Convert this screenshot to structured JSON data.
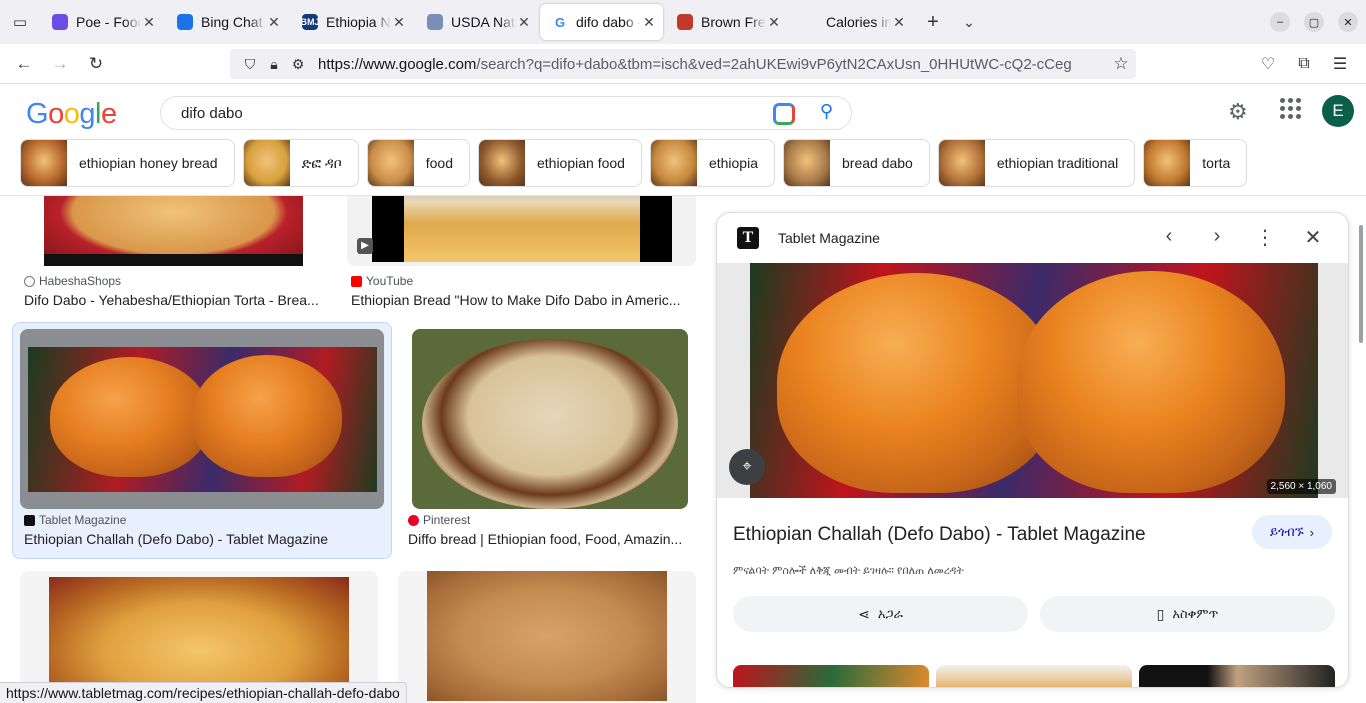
{
  "browser": {
    "tabs": [
      {
        "title": "Poe - Food Rec",
        "fav_color": "#6b4ce6",
        "fav_text": ""
      },
      {
        "title": "Bing Chat with",
        "fav_color": "#1a73e8",
        "fav_text": ""
      },
      {
        "title": "Ethiopia Nation",
        "fav_color": "#123a7a",
        "fav_text": "BMJ"
      },
      {
        "title": "USDA National",
        "fav_color": "#7a8fb5",
        "fav_text": ""
      },
      {
        "title": "difo dabo - Goo",
        "fav_color": "#4285f4",
        "fav_text": "G",
        "active": true
      },
      {
        "title": "Brown Fresh Gi",
        "fav_color": "#c0392b",
        "fav_text": ""
      },
      {
        "title": "Calories in large C",
        "fav_color": "#f0f0f4",
        "fav_text": ""
      }
    ],
    "url_host": "https://www.google.com",
    "url_rest": "/search?q=difo+dabo&tbm=isch&ved=2ahUKEwi9vP6ytN2CAxUsn_0HHUtWC-cQ2-cCeg",
    "status_url": "https://www.tabletmag.com/recipes/ethiopian-challah-defo-dabo"
  },
  "google": {
    "logo": "Google",
    "query": "difo dabo",
    "avatar_letter": "E",
    "chips": [
      {
        "label": "ethiopian honey bread",
        "color": "#b5652a"
      },
      {
        "label": "ድፎ ዳቦ",
        "color": "#d6a03c"
      },
      {
        "label": "food",
        "color": "#c98d4a"
      },
      {
        "label": "ethiopian food",
        "color": "#8f5a2e"
      },
      {
        "label": "ethiopia",
        "color": "#c4883d"
      },
      {
        "label": "bread dabo",
        "color": "#a87a4a"
      },
      {
        "label": "ethiopian traditional",
        "color": "#b07038"
      },
      {
        "label": "torta",
        "color": "#c0782e"
      }
    ]
  },
  "results": [
    {
      "source": "HabeshaShops",
      "caption": "Difo Dabo - Yehabesha/Ethiopian Torta - Brea...",
      "src_color": "#777"
    },
    {
      "source": "YouTube",
      "caption": "Ethiopian Bread \"How to Make Difo Dabo in Americ...",
      "src_color": "#ff0000"
    },
    {
      "source": "Tablet Magazine",
      "caption": "Ethiopian Challah (Defo Dabo) - Tablet Magazine",
      "src_color": "#111"
    },
    {
      "source": "Pinterest",
      "caption": "Diffo bread | Ethiopian food, Food, Amazin...",
      "src_color": "#e60023"
    }
  ],
  "panel": {
    "source": "Tablet Magazine",
    "logo_letter": "T",
    "title": "Ethiopian Challah (Defo Dabo) - Tablet Magazine",
    "visit_label": "ይጎብኙ",
    "description": "ምናልባት ምስሎች ለቅጂ መብት ይገዛሉ። የበለጠ ለመረዳት",
    "share_label": "አጋራ",
    "save_label": "አስቀምጥ",
    "dimensions": "2,560 × 1,060"
  }
}
